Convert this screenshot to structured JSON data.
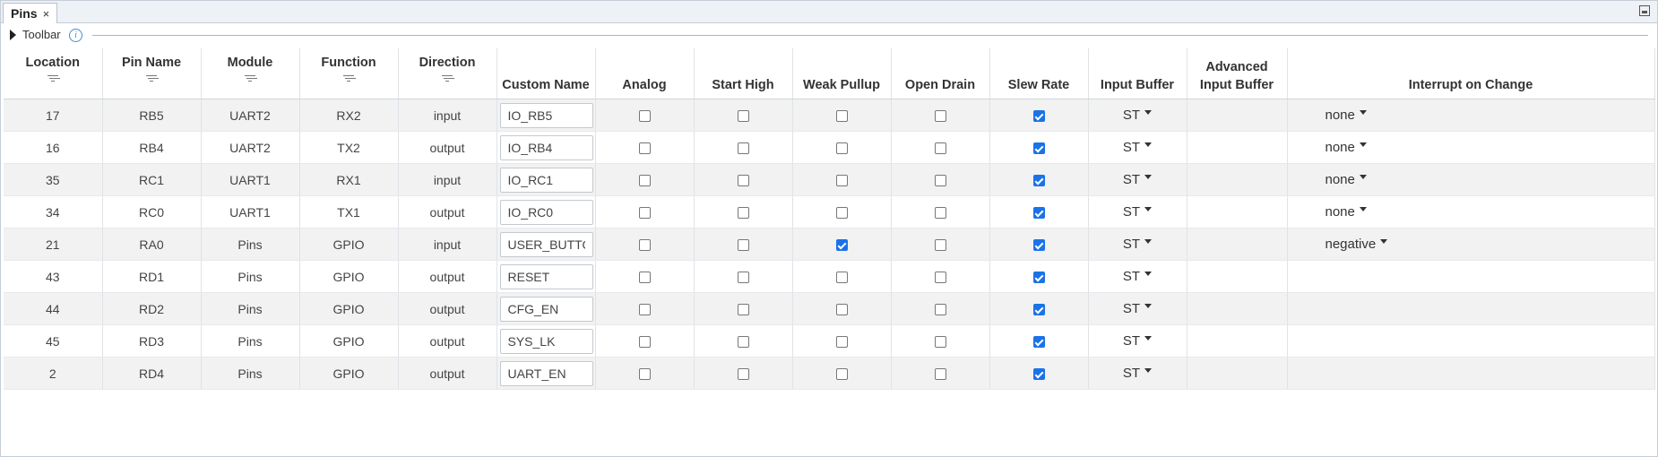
{
  "tab": {
    "label": "Pins",
    "close": "×"
  },
  "toolbar": {
    "label": "Toolbar",
    "info": "i"
  },
  "columns": [
    {
      "label": "Location",
      "filter": true
    },
    {
      "label": "Pin Name",
      "filter": true
    },
    {
      "label": "Module",
      "filter": true
    },
    {
      "label": "Function",
      "filter": true
    },
    {
      "label": "Direction",
      "filter": true
    },
    {
      "label": "Custom Name",
      "filter": false
    },
    {
      "label": "Analog",
      "filter": false
    },
    {
      "label": "Start High",
      "filter": false
    },
    {
      "label": "Weak Pullup",
      "filter": false
    },
    {
      "label": "Open Drain",
      "filter": false
    },
    {
      "label": "Slew Rate",
      "filter": false
    },
    {
      "label": "Input Buffer",
      "filter": false
    },
    {
      "label": "Advanced Input Buffer",
      "filter": false
    },
    {
      "label": "Interrupt on Change",
      "filter": false
    }
  ],
  "rows": [
    {
      "location": "17",
      "pin": "RB5",
      "module": "UART2",
      "function": "RX2",
      "direction": "input",
      "custom": "IO_RB5",
      "analog": false,
      "start_high": false,
      "weak_pullup": false,
      "open_drain": false,
      "slew_rate": true,
      "input_buffer": "ST",
      "adv_input_buffer": "",
      "ioc": "none"
    },
    {
      "location": "16",
      "pin": "RB4",
      "module": "UART2",
      "function": "TX2",
      "direction": "output",
      "custom": "IO_RB4",
      "analog": false,
      "start_high": false,
      "weak_pullup": false,
      "open_drain": false,
      "slew_rate": true,
      "input_buffer": "ST",
      "adv_input_buffer": "",
      "ioc": "none"
    },
    {
      "location": "35",
      "pin": "RC1",
      "module": "UART1",
      "function": "RX1",
      "direction": "input",
      "custom": "IO_RC1",
      "analog": false,
      "start_high": false,
      "weak_pullup": false,
      "open_drain": false,
      "slew_rate": true,
      "input_buffer": "ST",
      "adv_input_buffer": "",
      "ioc": "none"
    },
    {
      "location": "34",
      "pin": "RC0",
      "module": "UART1",
      "function": "TX1",
      "direction": "output",
      "custom": "IO_RC0",
      "analog": false,
      "start_high": false,
      "weak_pullup": false,
      "open_drain": false,
      "slew_rate": true,
      "input_buffer": "ST",
      "adv_input_buffer": "",
      "ioc": "none"
    },
    {
      "location": "21",
      "pin": "RA0",
      "module": "Pins",
      "function": "GPIO",
      "direction": "input",
      "custom": "USER_BUTTON",
      "analog": false,
      "start_high": false,
      "weak_pullup": true,
      "open_drain": false,
      "slew_rate": true,
      "input_buffer": "ST",
      "adv_input_buffer": "",
      "ioc": "negative"
    },
    {
      "location": "43",
      "pin": "RD1",
      "module": "Pins",
      "function": "GPIO",
      "direction": "output",
      "custom": "RESET",
      "analog": false,
      "start_high": false,
      "weak_pullup": false,
      "open_drain": false,
      "slew_rate": true,
      "input_buffer": "ST",
      "adv_input_buffer": "",
      "ioc": ""
    },
    {
      "location": "44",
      "pin": "RD2",
      "module": "Pins",
      "function": "GPIO",
      "direction": "output",
      "custom": "CFG_EN",
      "analog": false,
      "start_high": false,
      "weak_pullup": false,
      "open_drain": false,
      "slew_rate": true,
      "input_buffer": "ST",
      "adv_input_buffer": "",
      "ioc": ""
    },
    {
      "location": "45",
      "pin": "RD3",
      "module": "Pins",
      "function": "GPIO",
      "direction": "output",
      "custom": "SYS_LK",
      "analog": false,
      "start_high": false,
      "weak_pullup": false,
      "open_drain": false,
      "slew_rate": true,
      "input_buffer": "ST",
      "adv_input_buffer": "",
      "ioc": ""
    },
    {
      "location": "2",
      "pin": "RD4",
      "module": "Pins",
      "function": "GPIO",
      "direction": "output",
      "custom": "UART_EN",
      "analog": false,
      "start_high": false,
      "weak_pullup": false,
      "open_drain": false,
      "slew_rate": true,
      "input_buffer": "ST",
      "adv_input_buffer": "",
      "ioc": ""
    }
  ],
  "colors": {
    "checkbox_checked": "#1a73e8",
    "row_alt": "#f2f2f2"
  }
}
